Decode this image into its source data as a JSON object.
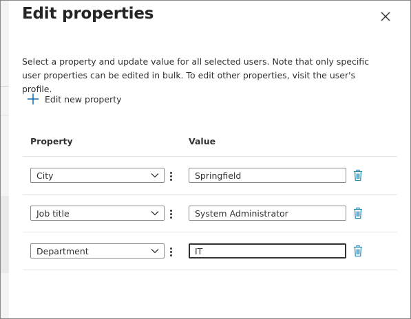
{
  "panel": {
    "title": "Edit properties",
    "description": "Select a property and update value for all selected users. Note that only specific user properties can be edited in bulk. To edit other properties, visit the user's profile.",
    "add_property_label": "Edit new property"
  },
  "table": {
    "headers": {
      "property": "Property",
      "value": "Value"
    },
    "rows": [
      {
        "property": "City",
        "value": "Springfield"
      },
      {
        "property": "Job title",
        "value": "System Administrator"
      },
      {
        "property": "Department",
        "value": "IT"
      }
    ]
  },
  "icons": {
    "close": "close-icon",
    "add": "plus-icon",
    "dropdown": "chevron-down-icon",
    "more": "more-vertical-icon",
    "delete": "trash-icon"
  },
  "colors": {
    "accent": "#0f6cbd",
    "delete_icon": "#2b88b3",
    "text": "#242424",
    "border": "#8a8886"
  }
}
